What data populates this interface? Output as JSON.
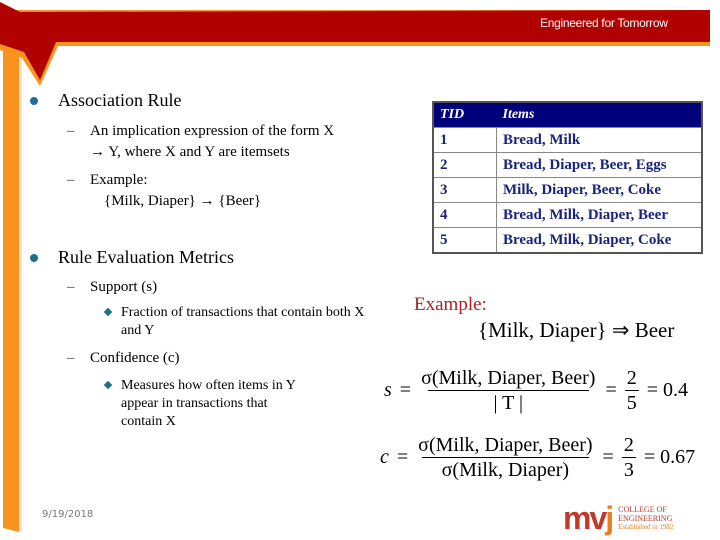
{
  "header": {
    "tagline": "Engineered for Tomorrow",
    "colors": {
      "banner": "#b00000",
      "accent": "#f7931e"
    }
  },
  "content": {
    "association_rule": {
      "title": "Association Rule",
      "items": [
        {
          "line1": "An implication expression of the form X",
          "line2": "→ Y, where X and Y are itemsets"
        },
        {
          "line1": "Example:",
          "line2": "{Milk, Diaper} → {Beer}"
        }
      ]
    },
    "metrics": {
      "title": "Rule Evaluation Metrics",
      "support": {
        "label": "Support (s)",
        "desc_line1": "Fraction of transactions that contain both X",
        "desc_line2": "and Y"
      },
      "confidence": {
        "label": "Confidence (c)",
        "desc_line1": "Measures how often items in Y",
        "desc_line2": "appear in transactions that",
        "desc_line3": "contain X"
      }
    }
  },
  "table": {
    "headers": [
      "TID",
      "Items"
    ],
    "rows": [
      {
        "tid": "1",
        "items": "Bread, Milk"
      },
      {
        "tid": "2",
        "items": "Bread, Diaper, Beer, Eggs"
      },
      {
        "tid": "3",
        "items": "Milk, Diaper, Beer, Coke"
      },
      {
        "tid": "4",
        "items": "Bread, Milk, Diaper, Beer"
      },
      {
        "tid": "5",
        "items": "Bread, Milk, Diaper, Coke"
      }
    ]
  },
  "example": {
    "label": "Example:",
    "rule": "{Milk, Diaper} ⇒ Beer",
    "support": {
      "var": "s",
      "eq": "=",
      "numerator": "σ(Milk, Diaper, Beer)",
      "denominator": "| T |",
      "frac_num": "2",
      "frac_den": "5",
      "result": "= 0.4"
    },
    "confidence": {
      "var": "c",
      "eq": "=",
      "numerator": "σ(Milk, Diaper, Beer)",
      "denominator": "σ(Milk, Diaper)",
      "frac_num": "2",
      "frac_den": "3",
      "result": "= 0.67"
    }
  },
  "footer": {
    "date": "9/19/2018",
    "logo": {
      "mark_m": "mv",
      "mark_j": "j",
      "line1": "COLLEGE OF",
      "line2": "ENGINEERING",
      "line3": "Established in 1982"
    }
  }
}
